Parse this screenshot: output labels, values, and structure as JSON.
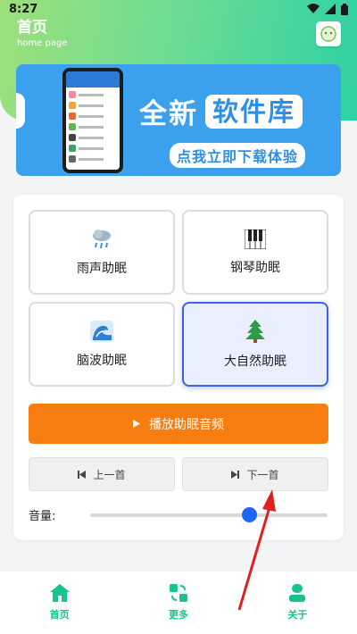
{
  "status": {
    "time": "8:27"
  },
  "header": {
    "title": "首页",
    "subtitle": "home page"
  },
  "banner": {
    "word1": "全新",
    "word2": "软件库",
    "cta": "点我立即下载体验"
  },
  "modes": [
    {
      "label": "雨声助眠",
      "icon": "rain-cloud-icon"
    },
    {
      "label": "钢琴助眠",
      "icon": "piano-icon"
    },
    {
      "label": "脑波助眠",
      "icon": "wave-icon"
    },
    {
      "label": "大自然助眠",
      "icon": "tree-icon",
      "selected": true
    }
  ],
  "player": {
    "play_label": "播放助眠音频",
    "prev_label": "上一首",
    "next_label": "下一首"
  },
  "volume": {
    "label": "音量:",
    "level": 0.67
  },
  "bottom_nav": [
    {
      "label": "首页",
      "icon": "home-icon"
    },
    {
      "label": "更多",
      "icon": "more-icon"
    },
    {
      "label": "关于",
      "icon": "user-icon"
    }
  ],
  "colors": {
    "accent_green": "#17c48c",
    "play_orange": "#f87d10",
    "selected_blue": "#3b63e8",
    "banner_blue": "#3ba0ee"
  }
}
